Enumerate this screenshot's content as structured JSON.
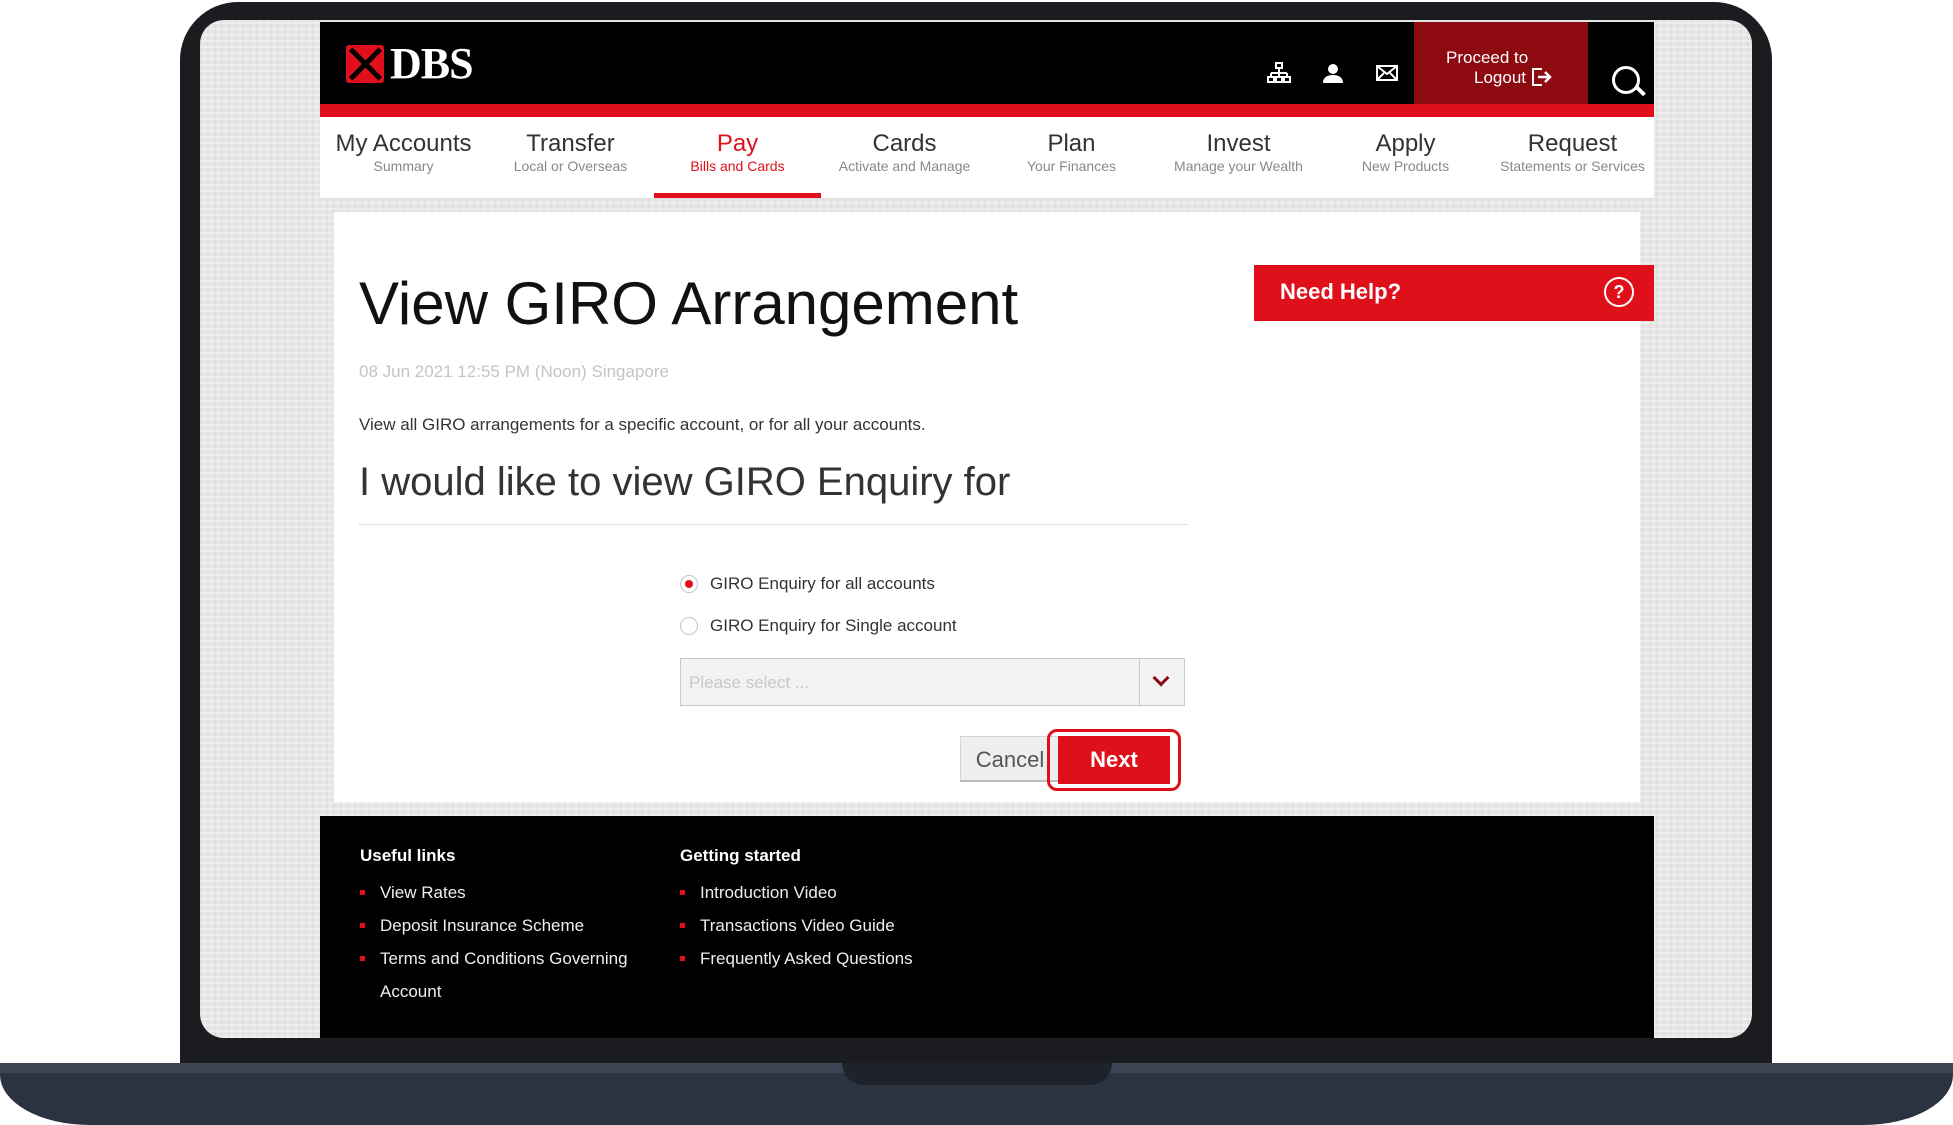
{
  "header": {
    "logo_text": "DBS",
    "logout_line1": "Proceed to",
    "logout_line2": "Logout"
  },
  "nav": {
    "items": [
      {
        "title": "My Accounts",
        "sub": "Summary"
      },
      {
        "title": "Transfer",
        "sub": "Local or Overseas"
      },
      {
        "title": "Pay",
        "sub": "Bills and Cards"
      },
      {
        "title": "Cards",
        "sub": "Activate and Manage"
      },
      {
        "title": "Plan",
        "sub": "Your Finances"
      },
      {
        "title": "Invest",
        "sub": "Manage your Wealth"
      },
      {
        "title": "Apply",
        "sub": "New Products"
      },
      {
        "title": "Request",
        "sub": "Statements or Services"
      }
    ]
  },
  "main": {
    "title": "View GIRO Arrangement",
    "timestamp": "08 Jun 2021 12:55 PM (Noon) Singapore",
    "description": "View all GIRO arrangements for a specific account, or for all your accounts.",
    "subheading": "I would like to view GIRO Enquiry for",
    "radio_all": "GIRO Enquiry for all accounts",
    "radio_single": "GIRO Enquiry for Single account",
    "select_placeholder": "Please select ...",
    "cancel_label": "Cancel",
    "next_label": "Next"
  },
  "help": {
    "label": "Need Help?",
    "icon_glyph": "?"
  },
  "footer": {
    "useful_heading": "Useful links",
    "useful": [
      "View Rates",
      "Deposit Insurance Scheme",
      "Terms and Conditions Governing",
      "Account"
    ],
    "getting_heading": "Getting started",
    "getting": [
      "Introduction Video",
      "Transactions Video Guide",
      "Frequently Asked Questions"
    ]
  },
  "colors": {
    "brand_red": "#e0101b",
    "dark_red": "#8c0a10"
  }
}
